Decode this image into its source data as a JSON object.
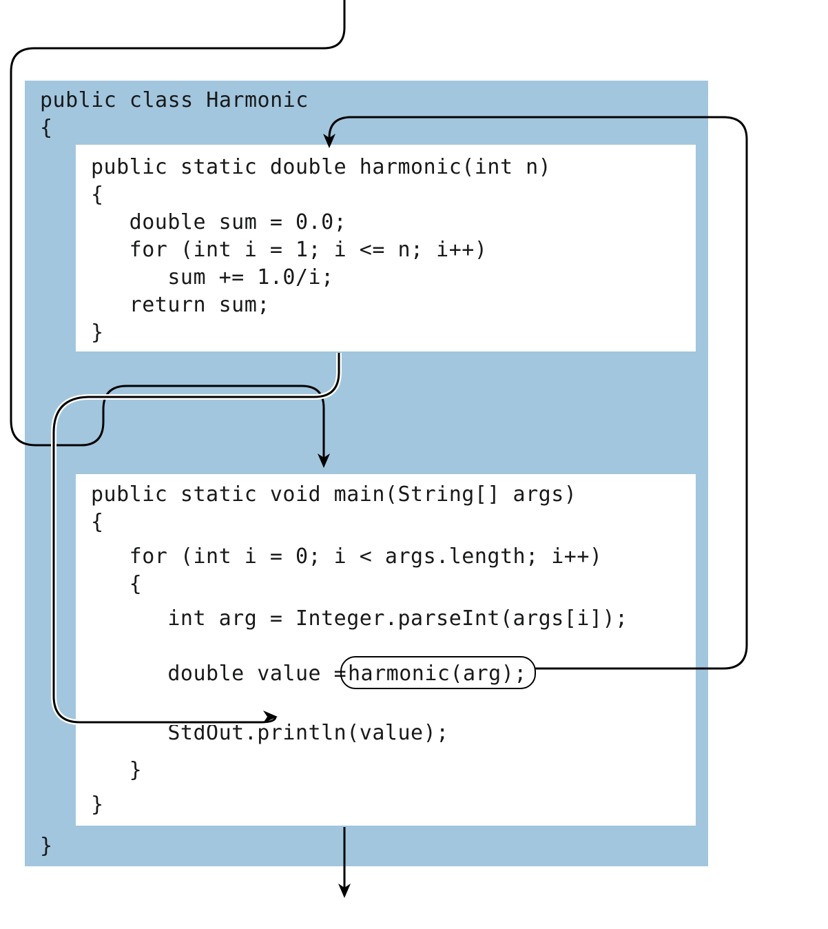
{
  "colors": {
    "box_bg": "#a2c6de",
    "inner_bg": "#ffffff",
    "text": "#18191a",
    "stroke": "#000000"
  },
  "class_decl": {
    "l1": "public class Harmonic",
    "l2": "{",
    "l_end": "}"
  },
  "harmonic_method": {
    "l1": "public static double harmonic(int n)",
    "l2": "{",
    "l3": "   double sum = 0.0;",
    "l4": "   for (int i = 1; i <= n; i++)",
    "l5": "      sum += 1.0/i;",
    "l6": "   return sum;",
    "l7": "}"
  },
  "main_method": {
    "l1": "public static void main(String[] args)",
    "l2": "{",
    "l3": "   for (int i = 0; i < args.length; i++)",
    "l4": "   {",
    "l5": "      int arg = Integer.parseInt(args[i]);",
    "l6a": "      double value = ",
    "l6b": "harmonic(arg);",
    "l7": "      StdOut.println(value);",
    "l8": "   }",
    "l9": "}"
  }
}
